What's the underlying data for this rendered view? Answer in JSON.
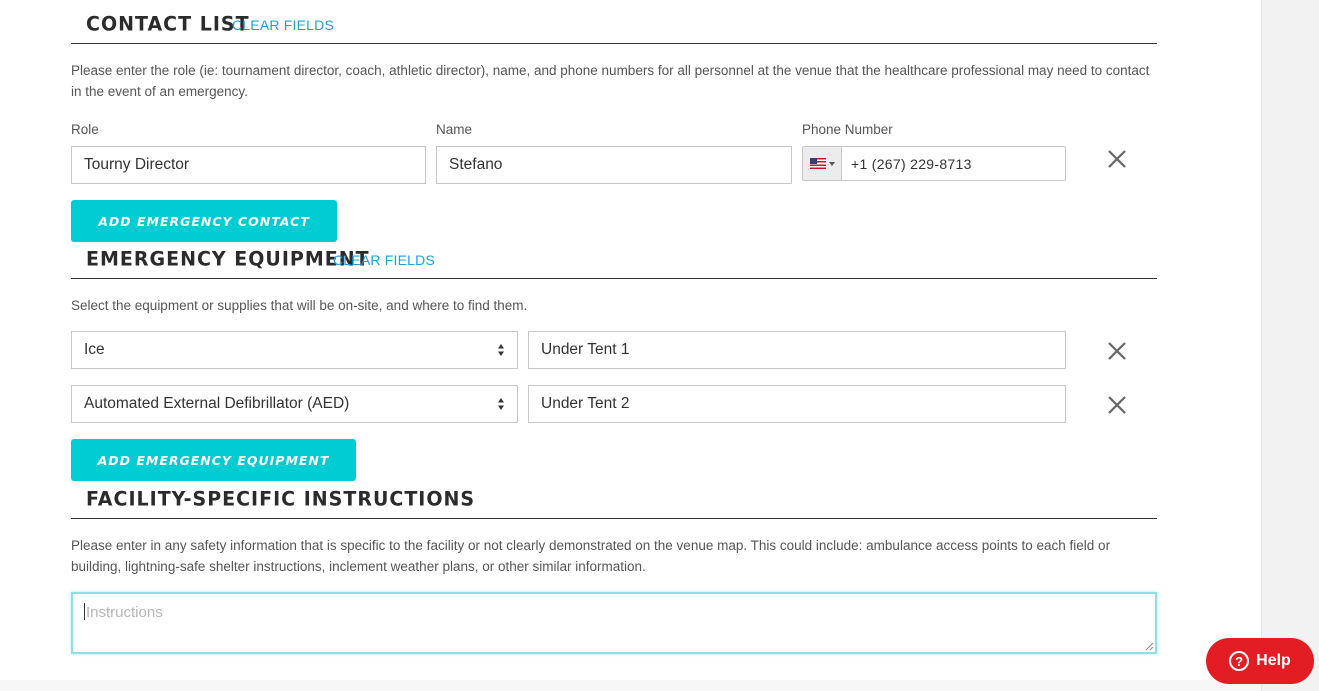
{
  "contact_list": {
    "title": "CONTACT LIST",
    "clear_label": "CLEAR FIELDS",
    "description": "Please enter the role (ie: tournament director, coach, athletic director), name, and phone numbers for all personnel at the venue that the healthcare professional may need to contact in the event of an emergency.",
    "role_label": "Role",
    "name_label": "Name",
    "phone_label": "Phone Number",
    "contacts": [
      {
        "role": "Tourny Director",
        "name": "Stefano",
        "phone": "+1 (267) 229-8713",
        "country": "us-flag-icon"
      }
    ],
    "add_label": "ADD EMERGENCY CONTACT"
  },
  "emergency_equipment": {
    "title": "EMERGENCY EQUIPMENT",
    "clear_label": "CLEAR FIELDS",
    "description": "Select the equipment or supplies that will be on-site, and where to find them.",
    "items": [
      {
        "equipment": "Ice",
        "location": "Under Tent 1"
      },
      {
        "equipment": "Automated External Defibrillator (AED)",
        "location": "Under Tent 2"
      }
    ],
    "add_label": "ADD EMERGENCY EQUIPMENT"
  },
  "facility_instructions": {
    "title": "FACILITY-SPECIFIC INSTRUCTIONS",
    "description": "Please enter in any safety information that is specific to the facility or not clearly demonstrated on the venue map. This could include: ambulance access points to each field or building, lightning-safe shelter instructions, inclement weather plans, or other similar information.",
    "placeholder": "Instructions",
    "value": ""
  },
  "help_button": {
    "label": "Help"
  },
  "colors": {
    "accent": "#00cdd3",
    "link": "#1ba3d6",
    "help": "#e21d23"
  }
}
